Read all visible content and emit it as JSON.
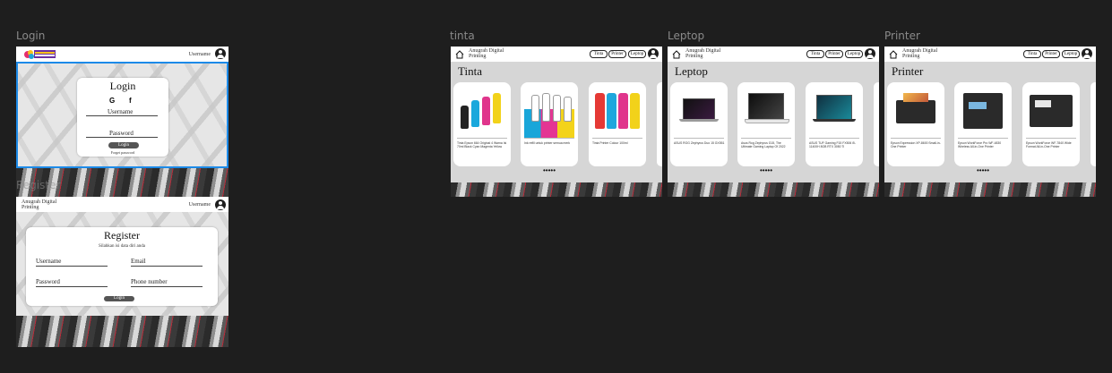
{
  "frames": {
    "login": "Login",
    "tinta": "tinta",
    "leptop": "Leptop",
    "printer": "Printer"
  },
  "login_page": {
    "username_label": "Username",
    "title": "Login",
    "google_icon": "G",
    "facebook_icon": "f",
    "field_username": "Username",
    "field_password": "Password",
    "button": "Login",
    "forgot": "Forget password",
    "ghost_label": "Register"
  },
  "register_page": {
    "brand_line1": "Anugrah Digital",
    "brand_line2": "Printing",
    "username_label": "Username",
    "title": "Register",
    "subtitle": "Silahkan isi data diri anda",
    "field_username": "Username",
    "field_email": "Email",
    "field_password": "Password",
    "field_phone": "Phone number",
    "button": "Login"
  },
  "shop": {
    "brand_line1": "Anugrah Digital",
    "brand_line2": "Printing",
    "nav": [
      "Tinta",
      "Printer",
      "Leptop"
    ],
    "dots": "•••••"
  },
  "tinta_page": {
    "title": "Tinta",
    "products": [
      "Tinta Epson 664 Original 4 Warna Isi 70ml Black Cyan Magenta Yellow",
      "Ink refill untuk printer semua merk",
      "Tinta Printer Colour 100ml"
    ]
  },
  "leptop_page": {
    "title": "Leptop",
    "products": [
      "ASUS ROG Zephyrus Duo 15 GX551",
      "Asus Rog Zephyrus G15, The Ultimate Gaming Laptop Of 2022",
      "ASUS TUF Gaming F15 FX506 i5-11400H 8GB RTX 3050 Ti"
    ]
  },
  "printer_page": {
    "title": "Printer",
    "products": [
      "Epson Expression XP-8600 Small-in-One Printer",
      "Epson WorkForce Pro WF-4830 Wireless All-in-One Printer",
      "Epson WorkForce WF-7840 Wide Format All-in-One Printer"
    ]
  }
}
